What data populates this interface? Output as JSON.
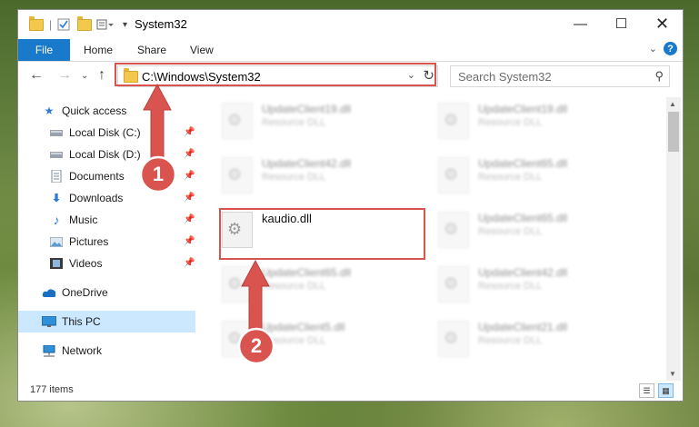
{
  "window": {
    "title": "System32"
  },
  "ribbon": {
    "tabs": [
      "File",
      "Home",
      "Share",
      "View"
    ]
  },
  "nav": {
    "address": "C:\\Windows\\System32",
    "search_placeholder": "Search System32"
  },
  "sidebar": {
    "items": [
      {
        "label": "Quick access"
      },
      {
        "label": "Local Disk (C:)"
      },
      {
        "label": "Local Disk (D:)"
      },
      {
        "label": "Documents"
      },
      {
        "label": "Downloads"
      },
      {
        "label": "Music"
      },
      {
        "label": "Pictures"
      },
      {
        "label": "Videos"
      },
      {
        "label": "OneDrive"
      },
      {
        "label": "This PC"
      },
      {
        "label": "Network"
      }
    ]
  },
  "files": [
    {
      "name": "UpdateClient19.dll",
      "type": "Resource DLL"
    },
    {
      "name": "UpdateClient19.dll",
      "type": "Resource DLL"
    },
    {
      "name": "UpdateClient42.dll",
      "type": "Resource DLL"
    },
    {
      "name": "UpdateClient65.dll",
      "type": "Resource DLL"
    },
    {
      "name": "kaudio.dll",
      "type": ""
    },
    {
      "name": "UpdateClient65.dll",
      "type": "Resource DLL"
    },
    {
      "name": "UpdateClient65.dll",
      "type": "Resource DLL"
    },
    {
      "name": "UpdateClient42.dll",
      "type": "Resource DLL"
    },
    {
      "name": "UpdateClient5.dll",
      "type": "Resource DLL"
    },
    {
      "name": "UpdateClient21.dll",
      "type": "Resource DLL"
    }
  ],
  "callouts": [
    "1",
    "2"
  ],
  "status": {
    "items": "177 items"
  },
  "colors": {
    "accent": "#1979ca",
    "highlight": "#d9534f",
    "selection": "#cce8ff"
  }
}
